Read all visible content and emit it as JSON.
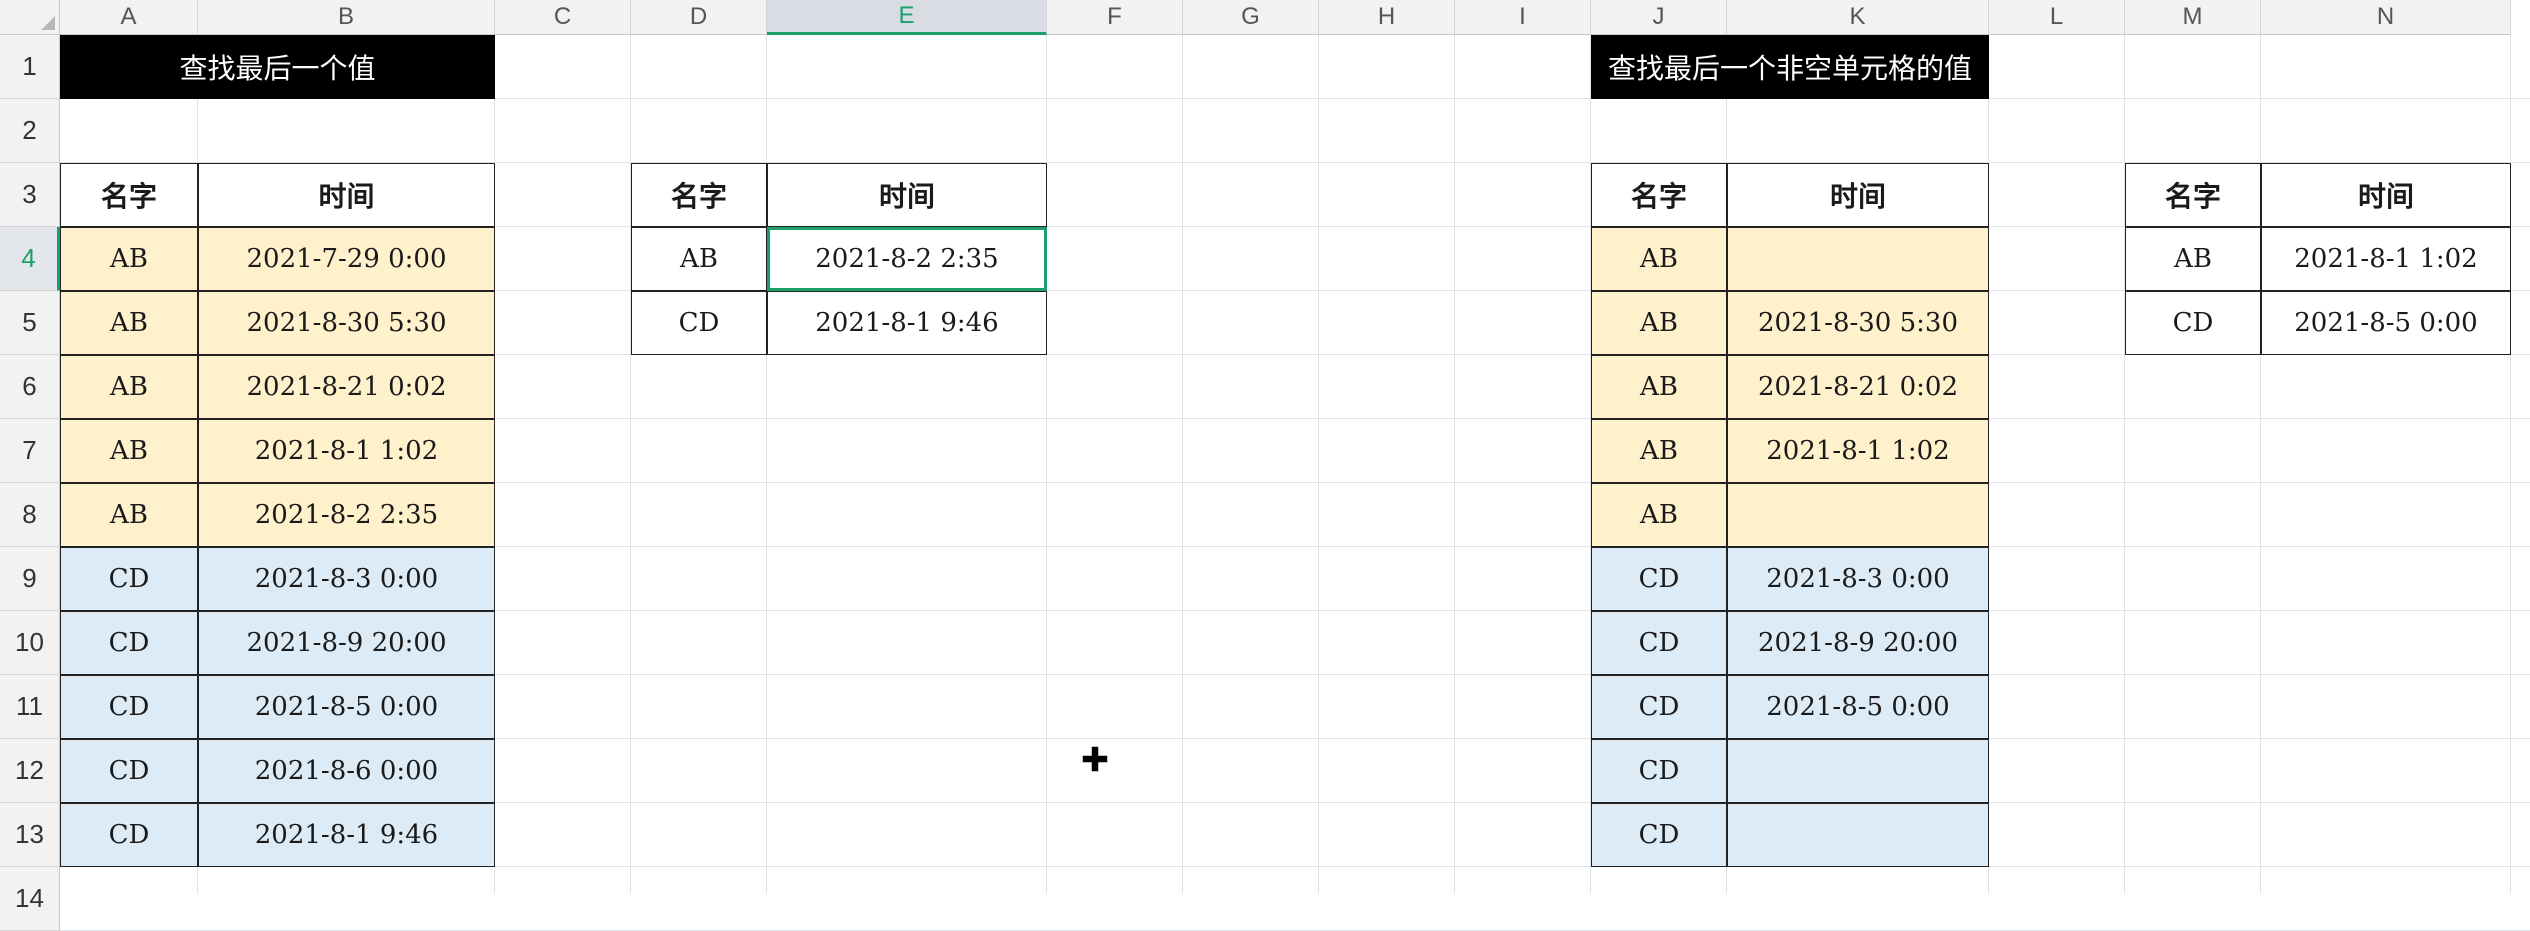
{
  "columns": [
    "A",
    "B",
    "C",
    "D",
    "E",
    "F",
    "G",
    "H",
    "I",
    "J",
    "K",
    "L",
    "M",
    "N"
  ],
  "rows": [
    "1",
    "2",
    "3",
    "4",
    "5",
    "6",
    "7",
    "8",
    "9",
    "10",
    "11",
    "12",
    "13",
    "14"
  ],
  "selected_cell": "E4",
  "colors": {
    "title_bg": "#000000",
    "yellow_fill": "#fff1cc",
    "blue_fill": "#ddebf7",
    "selection": "#1e9e6a"
  },
  "tables": {
    "title_last_value": "查找最后一个值",
    "title_last_nonblank": "查找最后一个非空单元格的值",
    "header_name": "名字",
    "header_time": "时间",
    "data1": [
      {
        "name": "AB",
        "time": "2021-7-29 0:00"
      },
      {
        "name": "AB",
        "time": "2021-8-30 5:30"
      },
      {
        "name": "AB",
        "time": "2021-8-21 0:02"
      },
      {
        "name": "AB",
        "time": "2021-8-1 1:02"
      },
      {
        "name": "AB",
        "time": "2021-8-2 2:35"
      },
      {
        "name": "CD",
        "time": "2021-8-3 0:00"
      },
      {
        "name": "CD",
        "time": "2021-8-9 20:00"
      },
      {
        "name": "CD",
        "time": "2021-8-5 0:00"
      },
      {
        "name": "CD",
        "time": "2021-8-6 0:00"
      },
      {
        "name": "CD",
        "time": "2021-8-1 9:46"
      }
    ],
    "result1": [
      {
        "name": "AB",
        "time": "2021-8-2 2:35"
      },
      {
        "name": "CD",
        "time": "2021-8-1 9:46"
      }
    ],
    "data2": [
      {
        "name": "AB",
        "time": ""
      },
      {
        "name": "AB",
        "time": "2021-8-30 5:30"
      },
      {
        "name": "AB",
        "time": "2021-8-21 0:02"
      },
      {
        "name": "AB",
        "time": "2021-8-1 1:02"
      },
      {
        "name": "AB",
        "time": ""
      },
      {
        "name": "CD",
        "time": "2021-8-3 0:00"
      },
      {
        "name": "CD",
        "time": "2021-8-9 20:00"
      },
      {
        "name": "CD",
        "time": "2021-8-5 0:00"
      },
      {
        "name": "CD",
        "time": ""
      },
      {
        "name": "CD",
        "time": ""
      }
    ],
    "result2": [
      {
        "name": "AB",
        "time": "2021-8-1 1:02"
      },
      {
        "name": "CD",
        "time": "2021-8-5 0:00"
      }
    ]
  },
  "cursor_icon": "crosshair-plus-icon"
}
